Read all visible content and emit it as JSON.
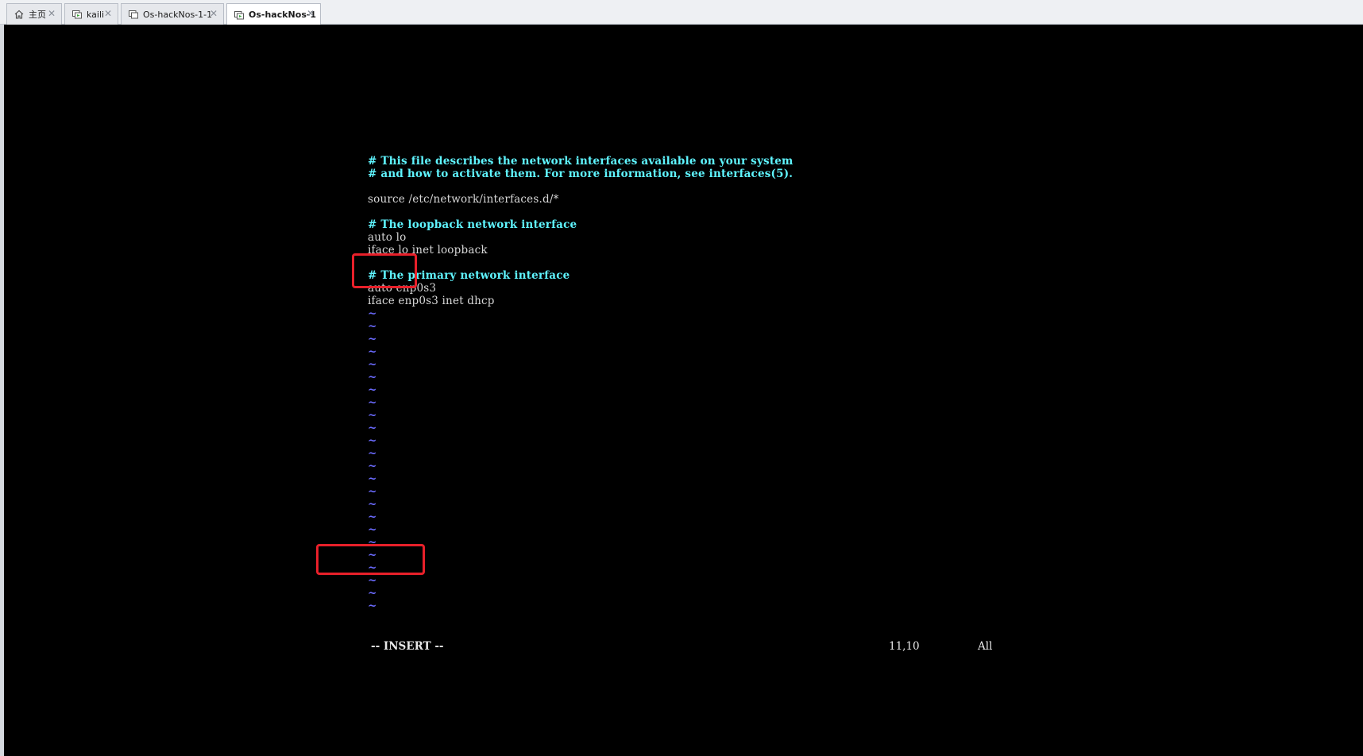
{
  "tabs": [
    {
      "label": "主页",
      "icon": "home-icon",
      "active": false
    },
    {
      "label": "kaili",
      "icon": "vm-icon",
      "active": false
    },
    {
      "label": "Os-hackNos-1-1",
      "icon": "vm-icon",
      "active": false
    },
    {
      "label": "Os-hackNos-1",
      "icon": "vm-icon",
      "active": true
    }
  ],
  "tab_close_glyph": "✕",
  "editor": {
    "lines": [
      {
        "text": "# This file describes the network interfaces available on your system",
        "kind": "comment"
      },
      {
        "text": "# and how to activate them. For more information, see interfaces(5).",
        "kind": "comment"
      },
      {
        "text": "",
        "kind": "text"
      },
      {
        "text": "source /etc/network/interfaces.d/*",
        "kind": "text"
      },
      {
        "text": "",
        "kind": "text"
      },
      {
        "text": "# The loopback network interface",
        "kind": "comment"
      },
      {
        "text": "auto lo",
        "kind": "text"
      },
      {
        "text": "iface lo inet loopback",
        "kind": "text"
      },
      {
        "text": "",
        "kind": "text"
      },
      {
        "text": "# The primary network interface",
        "kind": "comment"
      },
      {
        "text": "auto enp0s3",
        "kind": "text"
      },
      {
        "text": "iface enp0s3 inet dhcp",
        "kind": "text"
      }
    ],
    "tilde_count": 24,
    "tilde_glyph": "~",
    "mode": "-- INSERT --",
    "cursor_position": "11,10",
    "scroll_position": "All"
  },
  "colors": {
    "console_bg": "#000000",
    "comment": "#5ff5ff",
    "text": "#d8d8d8",
    "tilde": "#6b6bff",
    "annotation": "#e8202a"
  }
}
